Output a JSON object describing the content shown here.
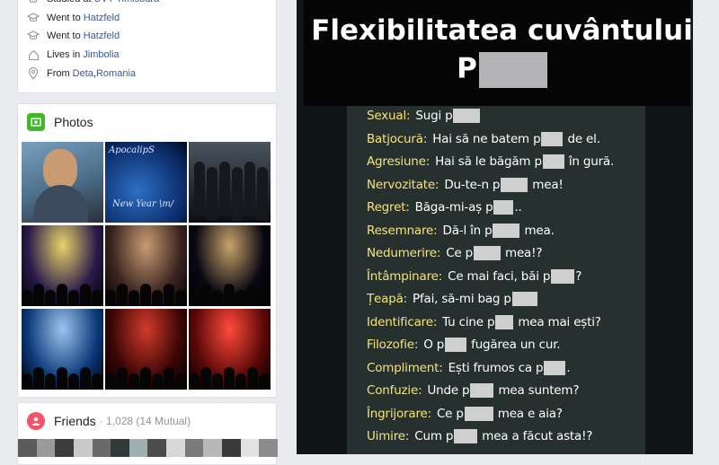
{
  "intro": {
    "rows": [
      {
        "icon": "graduation-cap-icon",
        "text": "Studied at",
        "link": "UVT Timisoara"
      },
      {
        "icon": "graduation-cap-icon",
        "text": "Went to",
        "link": "Hatzfeld"
      },
      {
        "icon": "graduation-cap-icon",
        "text": "Went to",
        "link": "Hatzfeld"
      },
      {
        "icon": "home-icon",
        "text": "Lives in",
        "link": "Jimbolia"
      },
      {
        "icon": "location-pin-icon",
        "text": "From",
        "link": "Deta",
        "link2": "Romania"
      }
    ]
  },
  "photos": {
    "title": "Photos",
    "tiles": [
      {
        "desc": "portrait",
        "colors": [
          "#4a6d87",
          "#c99b72"
        ]
      },
      {
        "desc": "album-cover",
        "caption_top": "ApocalipS",
        "caption_bottom": "New Year \\m/",
        "colors": [
          "#0a2a66",
          "#2c6fc4"
        ]
      },
      {
        "desc": "band-photo",
        "colors": [
          "#0b0d10",
          "#4a5560"
        ]
      },
      {
        "desc": "concert",
        "colors": [
          "#2a1a4a",
          "#e8d36a"
        ]
      },
      {
        "desc": "concert",
        "colors": [
          "#3a2420",
          "#c89c74"
        ]
      },
      {
        "desc": "concert",
        "colors": [
          "#0a0812",
          "#c9a36a"
        ]
      },
      {
        "desc": "concert",
        "colors": [
          "#0c3a7a",
          "#9cc4ec"
        ]
      },
      {
        "desc": "concert",
        "colors": [
          "#3a0606",
          "#d23a2a"
        ]
      },
      {
        "desc": "concert",
        "colors": [
          "#5a0808",
          "#ff4a3a"
        ]
      }
    ]
  },
  "friends": {
    "title": "Friends",
    "count": "· 1,028 (14 Mutual)"
  },
  "meme": {
    "title_line1": "Flexibilitatea cuvântului",
    "title_line2_prefix": "P",
    "rows": [
      {
        "label": "Sexual:",
        "before": "Sugi p",
        "after": ""
      },
      {
        "label": "Batjocură:",
        "before": "Hai să ne batem p",
        "after": "de el."
      },
      {
        "label": "Agresiune:",
        "before": "Hai să le băgăm p",
        "after": "în gură."
      },
      {
        "label": "Nervozitate:",
        "before": "Du-te-n p",
        "after": "mea!"
      },
      {
        "label": "Regret:",
        "before": "Băga-mi-aș p",
        "after": ".."
      },
      {
        "label": "Resemnare:",
        "before": "Dă-l în p",
        "after": "mea."
      },
      {
        "label": "Nedumerire:",
        "before": "Ce p",
        "after": "mea!?"
      },
      {
        "label": "Întâmpinare:",
        "before": "Ce mai faci, băi p",
        "after": "?"
      },
      {
        "label": "Țeapă:",
        "before": "Pfai, să-mi bag p",
        "after": ""
      },
      {
        "label": "Identificare:",
        "before": "Tu cine p",
        "after": "mea mai ești?"
      },
      {
        "label": "Filozofie:",
        "before": "O p",
        "after": "fugărea un cur."
      },
      {
        "label": "Compliment:",
        "before": "Ești frumos ca p",
        "after": "."
      },
      {
        "label": "Confuzie:",
        "before": "Unde p",
        "after": "mea suntem?"
      },
      {
        "label": "Îngrijorare:",
        "before": "Ce p",
        "after": "mea e aia?"
      },
      {
        "label": "Uimire:",
        "before": "Cum p",
        "after": "mea a făcut asta!?"
      }
    ]
  },
  "colors": {
    "link": "#385898",
    "meme_label": "#f6e27a",
    "photos_badge": "#42b72a",
    "friends_badge": "#f35369"
  }
}
